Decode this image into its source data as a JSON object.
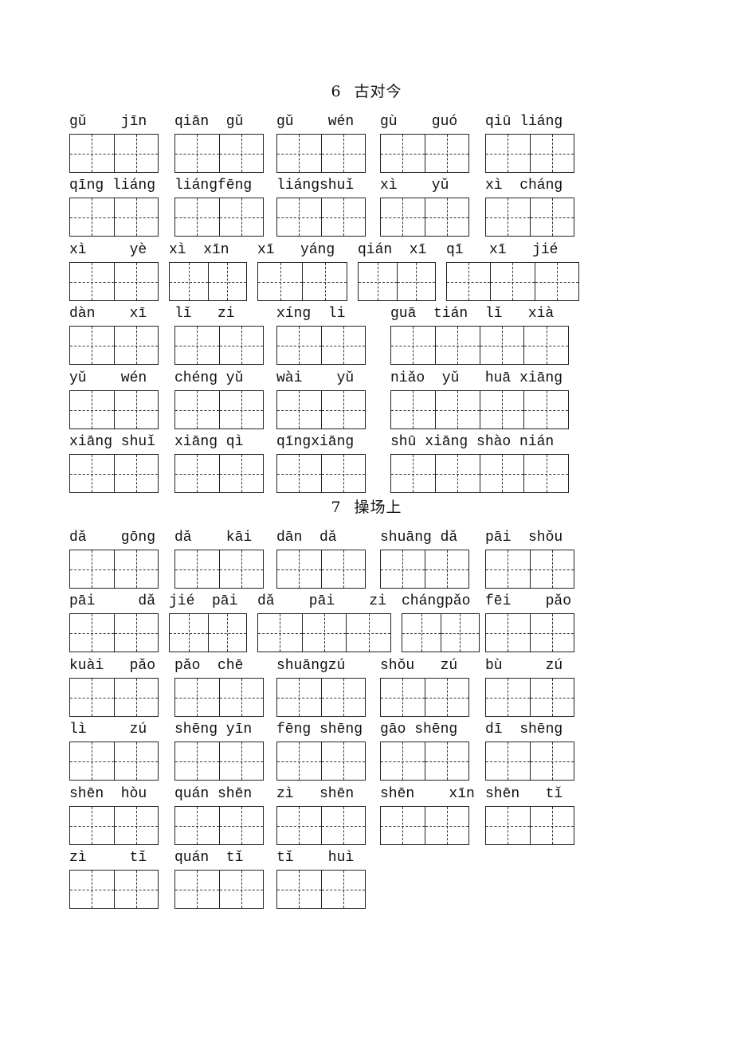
{
  "sections": [
    {
      "number": "6",
      "title": "古对今",
      "rows": [
        {
          "groups": [
            {
              "pinyin": "gǔ    jīn",
              "cells": 2
            },
            {
              "pinyin": "qiān  gǔ",
              "cells": 2
            },
            {
              "pinyin": "gǔ    wén",
              "cells": 2
            },
            {
              "pinyin": "gù    guó",
              "cells": 2
            },
            {
              "pinyin": "qiū liáng",
              "cells": 2
            }
          ]
        },
        {
          "groups": [
            {
              "pinyin": "qīng liáng",
              "cells": 2
            },
            {
              "pinyin": "liángfēng",
              "cells": 2
            },
            {
              "pinyin": "liángshuǐ",
              "cells": 2
            },
            {
              "pinyin": "xì    yǔ",
              "cells": 2
            },
            {
              "pinyin": "xì  cháng",
              "cells": 2
            }
          ]
        },
        {
          "groups": [
            {
              "pinyin": "xì     yè",
              "cells": 2
            },
            {
              "pinyin": "xì  xīn",
              "cells": 2
            },
            {
              "pinyin": "xī   yáng",
              "cells": 2
            },
            {
              "pinyin": "qián  xī",
              "cells": 2
            },
            {
              "pinyin": "qī   xī   jié",
              "cells": 3
            }
          ]
        },
        {
          "groups": [
            {
              "pinyin": "dàn    xī",
              "cells": 2
            },
            {
              "pinyin": "lǐ   zi",
              "cells": 2
            },
            {
              "pinyin": "xíng  li",
              "cells": 2
            },
            {
              "pinyin": "guā  tián  lǐ   xià",
              "cells": 4
            }
          ]
        },
        {
          "groups": [
            {
              "pinyin": "yǔ    wén",
              "cells": 2
            },
            {
              "pinyin": "chéng yǔ",
              "cells": 2
            },
            {
              "pinyin": "wài    yǔ",
              "cells": 2
            },
            {
              "pinyin": "niǎo  yǔ   huā xiāng",
              "cells": 4
            }
          ]
        },
        {
          "groups": [
            {
              "pinyin": "xiāng shuǐ",
              "cells": 2
            },
            {
              "pinyin": "xiāng qì",
              "cells": 2
            },
            {
              "pinyin": "qīngxiāng",
              "cells": 2
            },
            {
              "pinyin": "shū xiāng shào nián",
              "cells": 4
            }
          ]
        }
      ]
    },
    {
      "number": "7",
      "title": "操场上",
      "rows": [
        {
          "groups": [
            {
              "pinyin": "dǎ    gōng",
              "cells": 2
            },
            {
              "pinyin": "dǎ    kāi",
              "cells": 2
            },
            {
              "pinyin": "dān  dǎ",
              "cells": 2
            },
            {
              "pinyin": "shuāng dǎ",
              "cells": 2
            },
            {
              "pinyin": "pāi  shǒu",
              "cells": 2
            }
          ]
        },
        {
          "groups": [
            {
              "pinyin": "pāi     dǎ",
              "cells": 2
            },
            {
              "pinyin": "jié  pāi",
              "cells": 2
            },
            {
              "pinyin": "dǎ    pāi    zi",
              "cells": 3
            },
            {
              "pinyin": "chángpǎo",
              "cells": 2
            },
            {
              "pinyin": "fēi    pǎo",
              "cells": 2
            }
          ]
        },
        {
          "groups": [
            {
              "pinyin": "kuài   pǎo",
              "cells": 2
            },
            {
              "pinyin": "pǎo  chē",
              "cells": 2
            },
            {
              "pinyin": "shuāngzú",
              "cells": 2
            },
            {
              "pinyin": "shǒu   zú",
              "cells": 2
            },
            {
              "pinyin": "bù     zú",
              "cells": 2
            }
          ]
        },
        {
          "groups": [
            {
              "pinyin": "lì     zú",
              "cells": 2
            },
            {
              "pinyin": "shēng yīn",
              "cells": 2
            },
            {
              "pinyin": "fēng shēng",
              "cells": 2
            },
            {
              "pinyin": "gāo shēng",
              "cells": 2
            },
            {
              "pinyin": "dī  shēng",
              "cells": 2
            }
          ]
        },
        {
          "groups": [
            {
              "pinyin": "shēn  hòu",
              "cells": 2
            },
            {
              "pinyin": "quán shēn",
              "cells": 2
            },
            {
              "pinyin": "zì   shēn",
              "cells": 2
            },
            {
              "pinyin": "shēn    xīn",
              "cells": 2
            },
            {
              "pinyin": "shēn   tǐ",
              "cells": 2
            }
          ]
        },
        {
          "groups": [
            {
              "pinyin": "zì     tǐ",
              "cells": 2
            },
            {
              "pinyin": "quán  tǐ",
              "cells": 2
            },
            {
              "pinyin": "tǐ    huì",
              "cells": 2
            }
          ]
        }
      ]
    }
  ]
}
